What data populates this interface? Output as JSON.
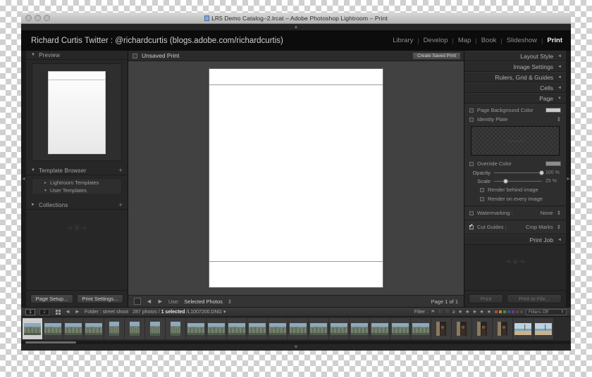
{
  "window": {
    "title": "LR5 Demo Catalog–2.lrcat – Adobe Photoshop Lightroom – Print",
    "doc_icon": "document-icon"
  },
  "header": {
    "identity_plate": "Richard Curtis Twitter : @richardcurtis (blogs.adobe.com/richardcurtis)",
    "modules": [
      {
        "label": "Library",
        "active": false
      },
      {
        "label": "Develop",
        "active": false
      },
      {
        "label": "Map",
        "active": false
      },
      {
        "label": "Book",
        "active": false
      },
      {
        "label": "Slideshow",
        "active": false
      },
      {
        "label": "Print",
        "active": true
      }
    ],
    "separator": "|"
  },
  "left_panel": {
    "preview": {
      "title": "Preview",
      "triangle": "▼"
    },
    "template_browser": {
      "title": "Template Browser",
      "triangle": "▼",
      "plus": "+",
      "items": [
        {
          "label": "Lightroom Templates",
          "triangle": "►"
        },
        {
          "label": "User Templates",
          "triangle": "▼"
        }
      ]
    },
    "collections": {
      "title": "Collections",
      "triangle": "►",
      "plus": "+"
    },
    "buttons": {
      "page_setup": "Page Setup...",
      "print_settings": "Print Settings..."
    }
  },
  "center": {
    "print_name": "Unsaved Print",
    "create_saved_print": "Create Saved Print",
    "toolbar": {
      "grid_icon": "grid-view-icon",
      "prev_icon": "◄",
      "next_icon": "►",
      "use_label": "Use:",
      "use_value": "Selected Photos",
      "use_chevron": "⇕",
      "page_count": "Page 1 of 1"
    }
  },
  "right_panel": {
    "panels": [
      {
        "label": "Layout Style",
        "arrow": "◄"
      },
      {
        "label": "Image Settings",
        "arrow": "◄"
      },
      {
        "label": "Rulers, Grid & Guides",
        "arrow": "◄"
      },
      {
        "label": "Cells",
        "arrow": "◄"
      },
      {
        "label": "Page",
        "arrow": "▼"
      }
    ],
    "page": {
      "background_color": {
        "label": "Page Background Color",
        "checked": false
      },
      "identity_plate": {
        "label": "Identity Plate",
        "checked": false,
        "chevron": "⇕"
      },
      "override_color": {
        "label": "Override Color",
        "checked": false
      },
      "opacity": {
        "label": "Opacity",
        "value": "100 %",
        "percent": 100
      },
      "scale": {
        "label": "Scale",
        "value": "25 %",
        "percent": 25
      },
      "render_behind": {
        "label": "Render behind image",
        "checked": false
      },
      "render_every": {
        "label": "Render on every image",
        "checked": false
      },
      "watermarking": {
        "label": "Watermarking :",
        "value": "None",
        "checked": false,
        "chevron": "⇕"
      },
      "cut_guides": {
        "label": "Cut Guides :",
        "value": "Crop Marks",
        "checked": true,
        "chevron": "⇕"
      }
    },
    "print_job": {
      "label": "Print Job",
      "arrow": "◄"
    },
    "buttons": {
      "print": "Print",
      "print_to_file": "Print to File..."
    }
  },
  "filmstrip": {
    "page_back": "1",
    "page_forward": "2",
    "grid_icon": "grid-icon",
    "prev_icon": "◄",
    "next_icon": "►",
    "source": "Folder : street shoot",
    "count_prefix": "287 photos /",
    "count_selected": "1 selected",
    "count_suffix": "/L1007200.DNG",
    "count_chevron": "▾",
    "filter_label": "Filter :",
    "flags": [
      "⚑",
      "⚐",
      "⚐"
    ],
    "rating_prefix": "≥",
    "stars": "★ ★ ★ ★ ★",
    "color_labels": [
      "#b04a3a",
      "#b08a2a",
      "#4f8a3a",
      "#3a4f8a",
      "#6a3a8a",
      "#4a4a4a",
      "#4a4a4a"
    ],
    "filters_off": "Filters Off",
    "filters_chevron": "⇕",
    "thumbnails": [
      {
        "kind": "city",
        "selected": true
      },
      {
        "kind": "city",
        "selected": false
      },
      {
        "kind": "city",
        "selected": false
      },
      {
        "kind": "city",
        "selected": false
      },
      {
        "kind": "city-p",
        "selected": false
      },
      {
        "kind": "city-p",
        "selected": false
      },
      {
        "kind": "city-p",
        "selected": false
      },
      {
        "kind": "city-p",
        "selected": false
      },
      {
        "kind": "city",
        "selected": false
      },
      {
        "kind": "city",
        "selected": false
      },
      {
        "kind": "city",
        "selected": false
      },
      {
        "kind": "city",
        "selected": false
      },
      {
        "kind": "city",
        "selected": false
      },
      {
        "kind": "city",
        "selected": false
      },
      {
        "kind": "city",
        "selected": false
      },
      {
        "kind": "city",
        "selected": false
      },
      {
        "kind": "city",
        "selected": false
      },
      {
        "kind": "city",
        "selected": false
      },
      {
        "kind": "city",
        "selected": false
      },
      {
        "kind": "city",
        "selected": false
      },
      {
        "kind": "portrait",
        "selected": false
      },
      {
        "kind": "portrait",
        "selected": false
      },
      {
        "kind": "portrait",
        "selected": false
      },
      {
        "kind": "portrait",
        "selected": false
      },
      {
        "kind": "beach",
        "selected": false
      },
      {
        "kind": "beach",
        "selected": false
      }
    ]
  },
  "chrome": {
    "chevron_up": "▲",
    "chevron_down": "▼"
  }
}
